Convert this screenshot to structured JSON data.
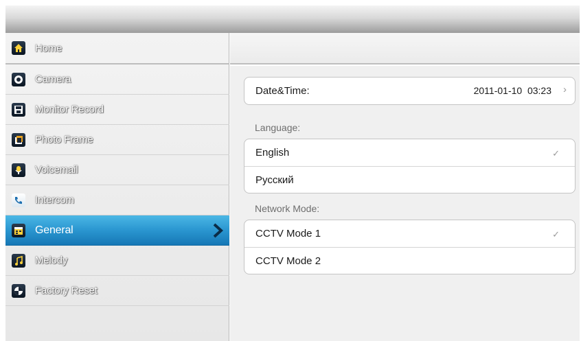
{
  "sidebar": {
    "items": [
      {
        "label": "Home",
        "icon": "home-icon"
      },
      {
        "label": "Camera",
        "icon": "camera-icon"
      },
      {
        "label": "Monitor Record",
        "icon": "floppy-disk-icon"
      },
      {
        "label": "Photo Frame",
        "icon": "photo-frame-icon"
      },
      {
        "label": "Voicemail",
        "icon": "microphone-icon"
      },
      {
        "label": "Intercom",
        "icon": "phone-icon"
      },
      {
        "label": "General",
        "icon": "calendar-icon",
        "active": true
      },
      {
        "label": "Melody",
        "icon": "music-note-icon"
      },
      {
        "label": "Factory Reset",
        "icon": "reset-icon"
      }
    ]
  },
  "settings": {
    "datetime": {
      "label": "Date&Time:",
      "value": "2011-01-10  03:23"
    },
    "language": {
      "section_label": "Language:",
      "options": [
        {
          "label": "English",
          "selected": true
        },
        {
          "label": "Русский",
          "selected": false
        }
      ]
    },
    "network": {
      "section_label": "Network Mode:",
      "options": [
        {
          "label": "CCTV Mode 1",
          "selected": true
        },
        {
          "label": "CCTV Mode 2",
          "selected": false
        }
      ]
    },
    "check_glyph": "✓",
    "arrow_glyph": "›"
  },
  "colors": {
    "accent": "#2a96d0",
    "icon_bg": "#1a2636"
  }
}
